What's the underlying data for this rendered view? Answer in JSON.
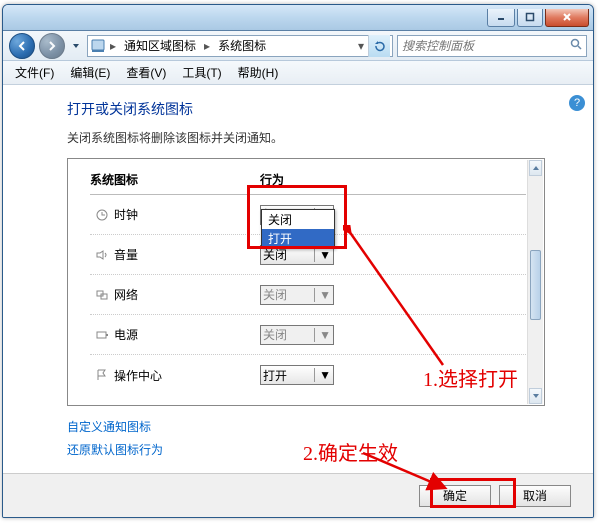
{
  "breadcrumb": {
    "seg1": "通知区域图标",
    "seg2": "系统图标"
  },
  "search": {
    "placeholder": "搜索控制面板"
  },
  "menu": {
    "file": "文件(F)",
    "edit": "编辑(E)",
    "view": "查看(V)",
    "tools": "工具(T)",
    "help": "帮助(H)"
  },
  "page": {
    "heading": "打开或关闭系统图标",
    "subtext": "关闭系统图标将删除该图标并关闭通知。",
    "col_icon": "系统图标",
    "col_behavior": "行为"
  },
  "options": {
    "open": "打开",
    "close": "关闭"
  },
  "rows": {
    "clock": {
      "label": "时钟",
      "value": "打开"
    },
    "volume": {
      "label": "音量",
      "value": "关闭"
    },
    "network": {
      "label": "网络",
      "value": "关闭"
    },
    "power": {
      "label": "电源",
      "value": "关闭"
    },
    "action": {
      "label": "操作中心",
      "value": "打开"
    }
  },
  "dropdown_open": {
    "opt1": "关闭",
    "opt2_hl": "打开"
  },
  "links": {
    "customize": "自定义通知图标",
    "restore": "还原默认图标行为"
  },
  "buttons": {
    "ok": "确定",
    "cancel": "取消"
  },
  "annotations": {
    "step1": "1.选择打开",
    "step2": "2.确定生效"
  },
  "help": "?"
}
